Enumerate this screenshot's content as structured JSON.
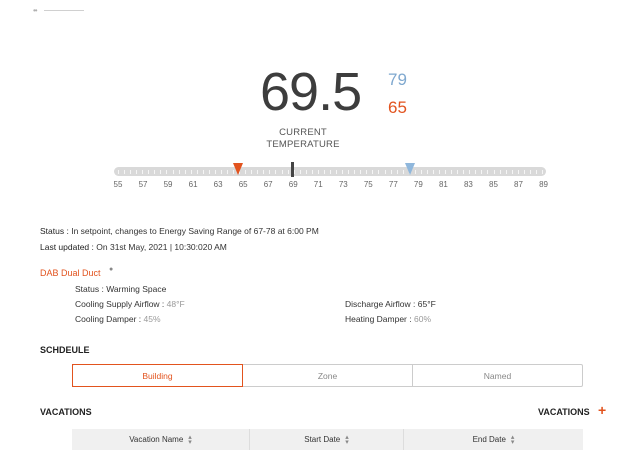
{
  "thermostat": {
    "current_temp": "69.5",
    "cooling_setpoint": "79",
    "heating_setpoint": "65",
    "current_label": "CURRENT TEMPERATURE",
    "scale_labels": [
      "55",
      "57",
      "59",
      "61",
      "63",
      "65",
      "67",
      "69",
      "71",
      "73",
      "75",
      "77",
      "79",
      "81",
      "83",
      "85",
      "87",
      "89"
    ],
    "colors": {
      "heat": "#e2531e",
      "cool": "#7fa8cf"
    }
  },
  "status": {
    "status_label": "Status :",
    "status_text": "In setpoint, changes to Energy Saving Range of 67-78 at 6:00 PM",
    "updated_label": "Last updated :",
    "updated_text": "On 31st May, 2021 | 10:30:020 AM"
  },
  "unit": {
    "name": "DAB Dual Duct",
    "status_label": "Status :",
    "status_value": "Warming Space",
    "cooling_supply_label": "Cooling Supply Airflow :",
    "cooling_supply_value": "48°F",
    "cooling_damper_label": "Cooling Damper :",
    "cooling_damper_value": "45%",
    "discharge_label": "Discharge Airflow :",
    "discharge_value": "65°F",
    "heating_damper_label": "Heating Damper :",
    "heating_damper_value": "60%"
  },
  "schedule": {
    "title": "SCHDEULE",
    "tabs": [
      "Building",
      "Zone",
      "Named"
    ]
  },
  "vacations": {
    "title": "VACATIONS",
    "add_label": "VACATIONS",
    "columns": [
      "Vacation Name",
      "Start Date",
      "End Date"
    ]
  }
}
